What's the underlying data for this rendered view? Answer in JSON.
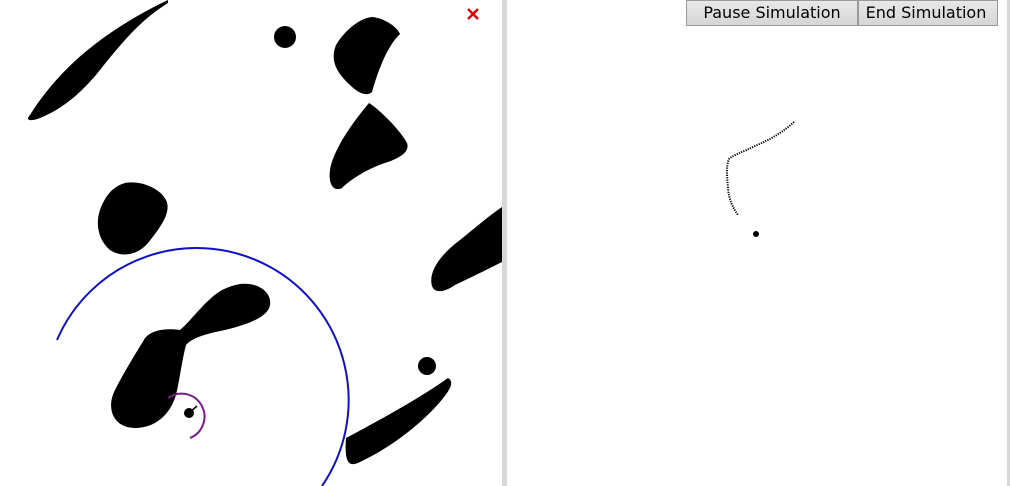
{
  "toolbar": {
    "pause_label": "Pause Simulation",
    "end_label": "End Simulation"
  },
  "icons": {
    "close": "close-icon",
    "close_glyph": "×"
  },
  "colors": {
    "obstacle": "#000000",
    "sensor_range": "#1010c8",
    "robot_heading": "#7a1a8a",
    "goal_marker": "#e00000",
    "trajectory": "#000000",
    "background": "#ffffff"
  }
}
